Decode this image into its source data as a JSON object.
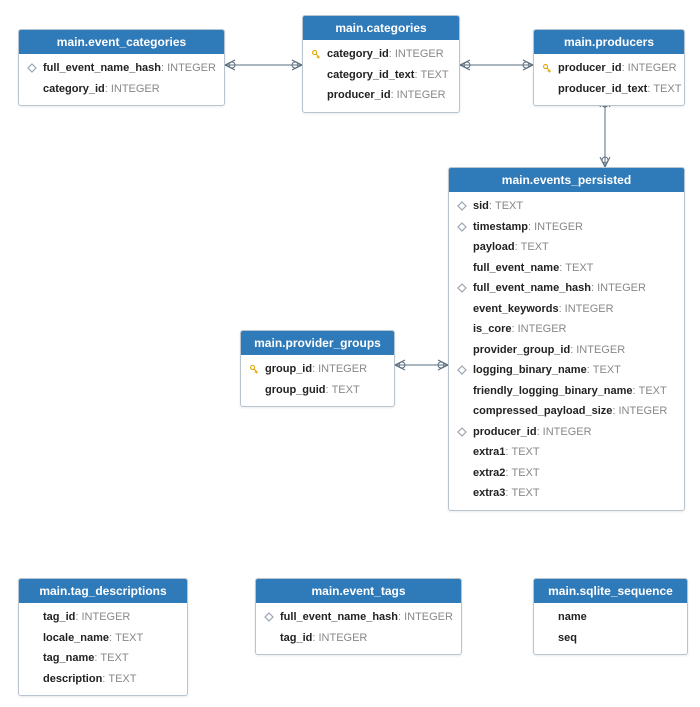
{
  "entities": {
    "event_categories": {
      "title": "main.event_categories",
      "fields": [
        {
          "icon": "diamond",
          "name": "full_event_name_hash",
          "type": "INTEGER"
        },
        {
          "icon": "none",
          "name": "category_id",
          "type": "INTEGER"
        }
      ]
    },
    "categories": {
      "title": "main.categories",
      "fields": [
        {
          "icon": "key",
          "name": "category_id",
          "type": "INTEGER"
        },
        {
          "icon": "none",
          "name": "category_id_text",
          "type": "TEXT"
        },
        {
          "icon": "none",
          "name": "producer_id",
          "type": "INTEGER"
        }
      ]
    },
    "producers": {
      "title": "main.producers",
      "fields": [
        {
          "icon": "key",
          "name": "producer_id",
          "type": "INTEGER"
        },
        {
          "icon": "none",
          "name": "producer_id_text",
          "type": "TEXT"
        }
      ]
    },
    "events_persisted": {
      "title": "main.events_persisted",
      "fields": [
        {
          "icon": "diamond",
          "name": "sid",
          "type": "TEXT"
        },
        {
          "icon": "diamond",
          "name": "timestamp",
          "type": "INTEGER"
        },
        {
          "icon": "none",
          "name": "payload",
          "type": "TEXT"
        },
        {
          "icon": "none",
          "name": "full_event_name",
          "type": "TEXT"
        },
        {
          "icon": "diamond",
          "name": "full_event_name_hash",
          "type": "INTEGER"
        },
        {
          "icon": "none",
          "name": "event_keywords",
          "type": "INTEGER"
        },
        {
          "icon": "none",
          "name": "is_core",
          "type": "INTEGER"
        },
        {
          "icon": "none",
          "name": "provider_group_id",
          "type": "INTEGER"
        },
        {
          "icon": "diamond",
          "name": "logging_binary_name",
          "type": "TEXT"
        },
        {
          "icon": "none",
          "name": "friendly_logging_binary_name",
          "type": "TEXT"
        },
        {
          "icon": "none",
          "name": "compressed_payload_size",
          "type": "INTEGER"
        },
        {
          "icon": "diamond",
          "name": "producer_id",
          "type": "INTEGER"
        },
        {
          "icon": "none",
          "name": "extra1",
          "type": "TEXT"
        },
        {
          "icon": "none",
          "name": "extra2",
          "type": "TEXT"
        },
        {
          "icon": "none",
          "name": "extra3",
          "type": "TEXT"
        }
      ]
    },
    "provider_groups": {
      "title": "main.provider_groups",
      "fields": [
        {
          "icon": "key",
          "name": "group_id",
          "type": "INTEGER"
        },
        {
          "icon": "none",
          "name": "group_guid",
          "type": "TEXT"
        }
      ]
    },
    "tag_descriptions": {
      "title": "main.tag_descriptions",
      "fields": [
        {
          "icon": "none",
          "name": "tag_id",
          "type": "INTEGER"
        },
        {
          "icon": "none",
          "name": "locale_name",
          "type": "TEXT"
        },
        {
          "icon": "none",
          "name": "tag_name",
          "type": "TEXT"
        },
        {
          "icon": "none",
          "name": "description",
          "type": "TEXT"
        }
      ]
    },
    "event_tags": {
      "title": "main.event_tags",
      "fields": [
        {
          "icon": "diamond",
          "name": "full_event_name_hash",
          "type": "INTEGER"
        },
        {
          "icon": "none",
          "name": "tag_id",
          "type": "INTEGER"
        }
      ]
    },
    "sqlite_sequence": {
      "title": "main.sqlite_sequence",
      "fields": [
        {
          "icon": "none",
          "name": "name",
          "type": ""
        },
        {
          "icon": "none",
          "name": "seq",
          "type": ""
        }
      ]
    }
  },
  "chart_data": {
    "type": "diagram",
    "diagram_type": "entity-relationship",
    "relations": [
      {
        "from": "event_categories",
        "to": "categories"
      },
      {
        "from": "categories",
        "to": "producers"
      },
      {
        "from": "producers",
        "to": "events_persisted"
      },
      {
        "from": "provider_groups",
        "to": "events_persisted"
      }
    ]
  }
}
